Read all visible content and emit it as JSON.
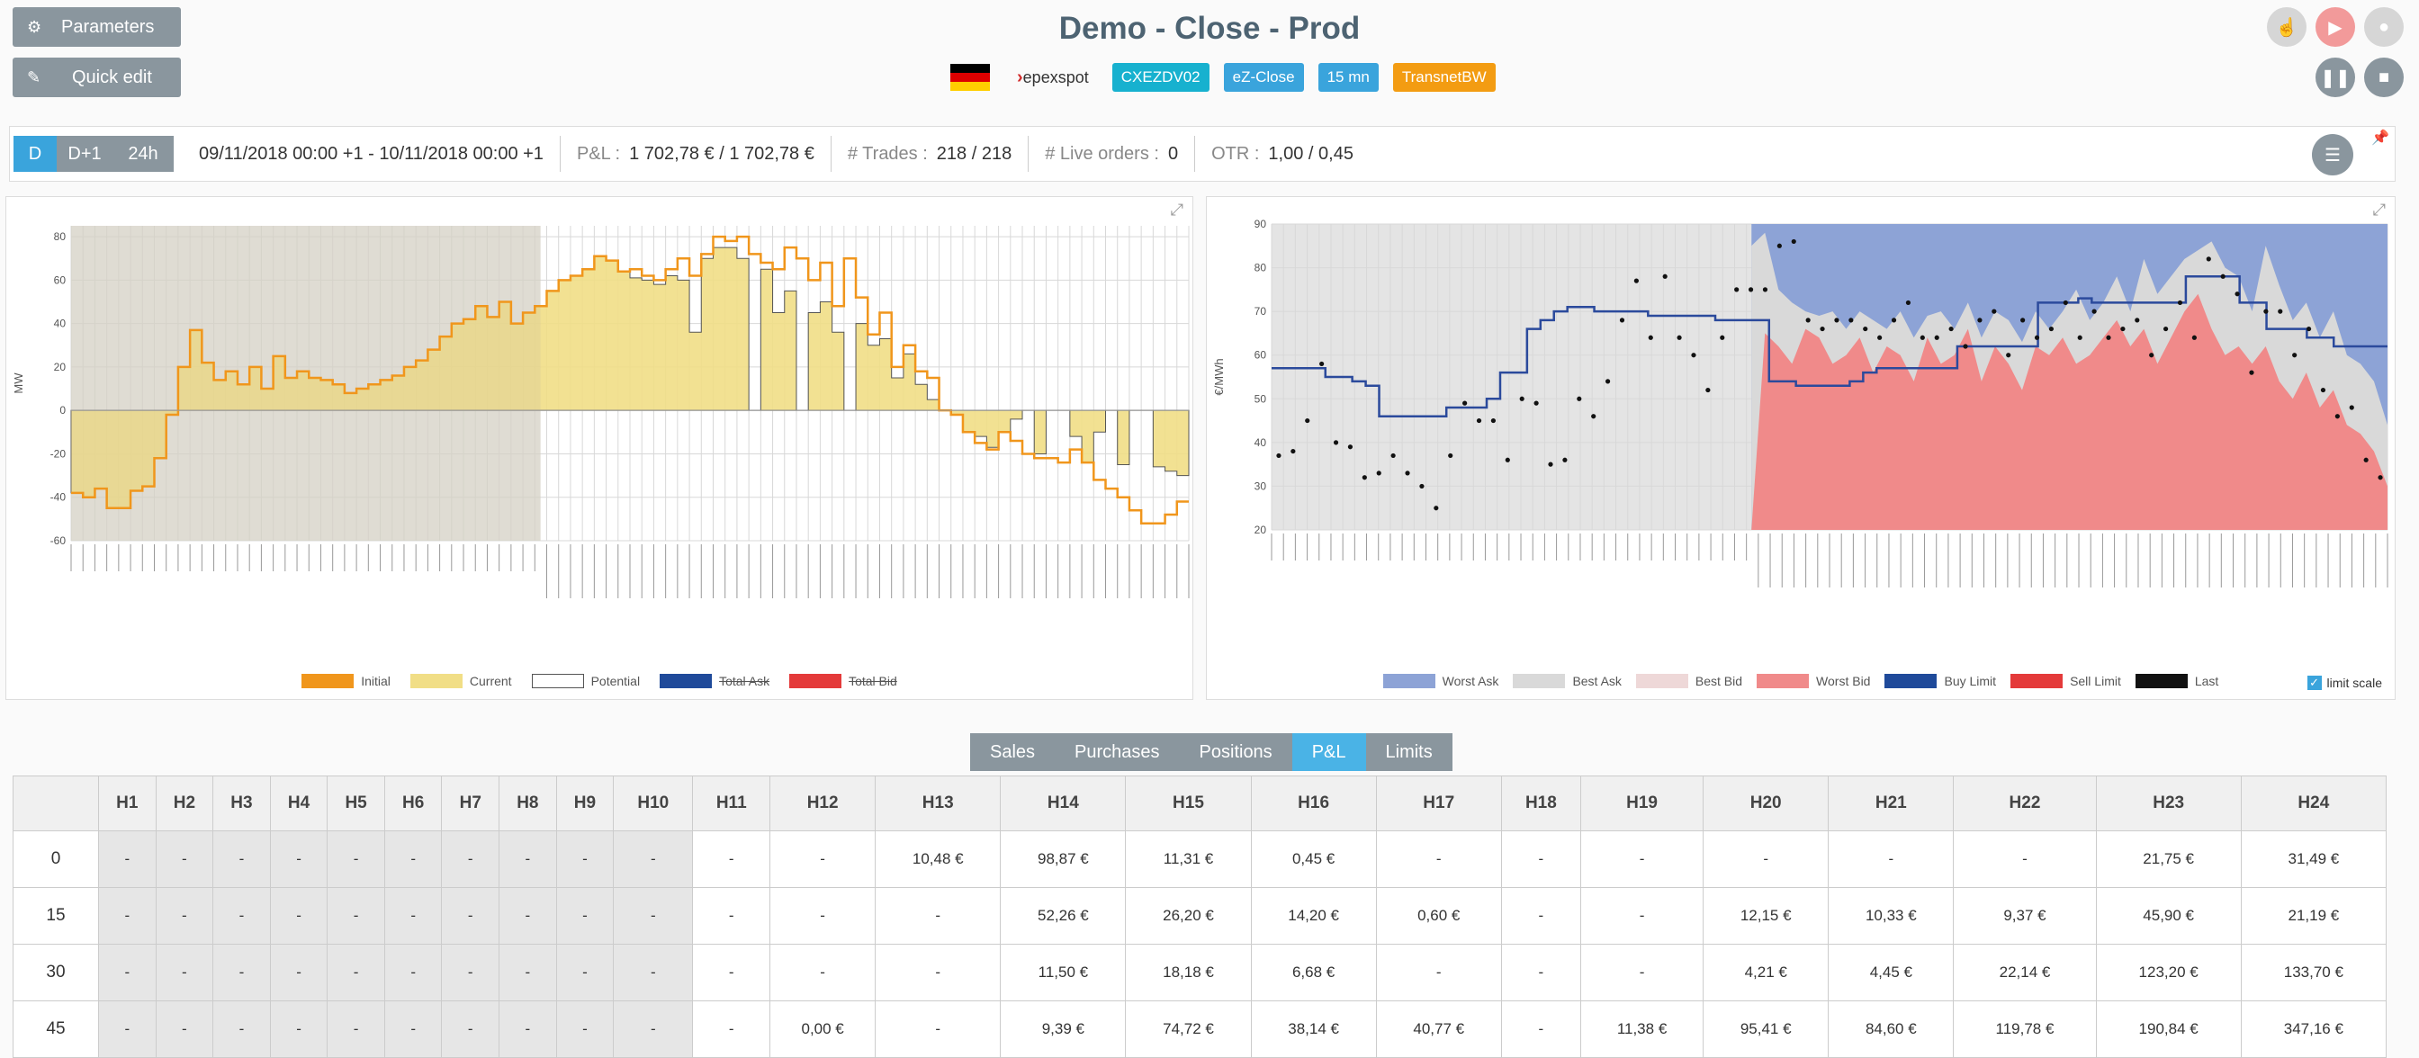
{
  "sidebar": {
    "parameters_label": "Parameters",
    "quick_edit_label": "Quick edit"
  },
  "header": {
    "title": "Demo - Close - Prod",
    "brand": "epexspot",
    "tags": [
      {
        "label": "CXEZDV02",
        "color": "#17b1cf"
      },
      {
        "label": "eZ-Close",
        "color": "#3aa4dc"
      },
      {
        "label": "15 mn",
        "color": "#3aa4dc"
      },
      {
        "label": "TransnetBW",
        "color": "#f39c12"
      }
    ]
  },
  "toolbar": {
    "day_tabs": [
      "D",
      "D+1",
      "24h"
    ],
    "active_day": "D",
    "period": "09/11/2018 00:00 +1 - 10/11/2018 00:00 +1",
    "pnl_label": "P&L :",
    "pnl_value": "1 702,78 € / 1 702,78 €",
    "trades_label": "# Trades :",
    "trades_value": "218 / 218",
    "live_label": "# Live orders :",
    "live_value": "0",
    "otr_label": "OTR :",
    "otr_value": "1,00 / 0,45"
  },
  "left_legend": [
    "Initial",
    "Current",
    "Potential",
    "Total Ask",
    "Total Bid"
  ],
  "right_legend": [
    "Worst Ask",
    "Best Ask",
    "Best Bid",
    "Worst Bid",
    "Buy Limit",
    "Sell Limit",
    "Last"
  ],
  "limit_scale_label": "limit scale",
  "tabs": [
    "Sales",
    "Purchases",
    "Positions",
    "P&L",
    "Limits"
  ],
  "active_tab": "P&L",
  "table": {
    "headers": [
      "H1",
      "H2",
      "H3",
      "H4",
      "H5",
      "H6",
      "H7",
      "H8",
      "H9",
      "H10",
      "H11",
      "H12",
      "H13",
      "H14",
      "H15",
      "H16",
      "H17",
      "H18",
      "H19",
      "H20",
      "H21",
      "H22",
      "H23",
      "H24"
    ],
    "rows": [
      {
        "label": "0",
        "cells": [
          "-",
          "-",
          "-",
          "-",
          "-",
          "-",
          "-",
          "-",
          "-",
          "-",
          "-",
          "-",
          "10,48 €",
          "98,87 €",
          "11,31 €",
          "0,45 €",
          "-",
          "-",
          "-",
          "-",
          "-",
          "-",
          "21,75 €",
          "31,49 €"
        ]
      },
      {
        "label": "15",
        "cells": [
          "-",
          "-",
          "-",
          "-",
          "-",
          "-",
          "-",
          "-",
          "-",
          "-",
          "-",
          "-",
          "-",
          "52,26 €",
          "26,20 €",
          "14,20 €",
          "0,60 €",
          "-",
          "-",
          "12,15 €",
          "10,33 €",
          "9,37 €",
          "45,90 €",
          "21,19 €"
        ]
      },
      {
        "label": "30",
        "cells": [
          "-",
          "-",
          "-",
          "-",
          "-",
          "-",
          "-",
          "-",
          "-",
          "-",
          "-",
          "-",
          "-",
          "11,50 €",
          "18,18 €",
          "6,68 €",
          "-",
          "-",
          "-",
          "4,21 €",
          "4,45 €",
          "22,14 €",
          "123,20 €",
          "133,70 €"
        ]
      },
      {
        "label": "45",
        "cells": [
          "-",
          "-",
          "-",
          "-",
          "-",
          "-",
          "-",
          "-",
          "-",
          "-",
          "-",
          "0,00 €",
          "-",
          "9,39 €",
          "74,72 €",
          "38,14 €",
          "40,77 €",
          "-",
          "11,38 €",
          "95,41 €",
          "84,60 €",
          "119,78 €",
          "190,84 €",
          "347,16 €"
        ]
      }
    ]
  },
  "chart_data": [
    {
      "type": "area",
      "ylabel": "MW",
      "ylim": [
        -60,
        85
      ],
      "yticks": [
        -60,
        -40,
        -20,
        0,
        20,
        40,
        60,
        80
      ],
      "series": [
        {
          "name": "Initial",
          "values": [
            -38,
            -40,
            -36,
            -45,
            -45,
            -37,
            -35,
            -22,
            -2,
            20,
            37,
            22,
            14,
            18,
            12,
            20,
            10,
            25,
            15,
            18,
            15,
            14,
            12,
            8,
            10,
            12,
            14,
            16,
            20,
            23,
            28,
            34,
            40,
            42,
            48,
            43,
            50,
            40,
            45,
            48,
            55,
            60,
            62,
            65,
            71,
            69,
            64,
            65,
            62,
            60,
            65,
            70,
            62,
            72,
            80,
            78,
            80,
            72,
            68,
            65,
            75,
            70,
            60,
            68,
            48,
            70,
            52,
            35,
            45,
            20,
            30,
            18,
            15,
            0,
            -2,
            -10,
            -15,
            -18,
            -10,
            -14,
            -20,
            -22,
            -22,
            -24,
            -18,
            -24,
            -32,
            -36,
            -40,
            -46,
            -52,
            -52,
            -48,
            -42
          ]
        },
        {
          "name": "Current",
          "values": [
            -38,
            -40,
            -36,
            -45,
            -45,
            -37,
            -35,
            -22,
            -2,
            20,
            37,
            22,
            14,
            18,
            12,
            20,
            10,
            25,
            15,
            18,
            15,
            14,
            12,
            8,
            10,
            12,
            14,
            16,
            20,
            23,
            28,
            34,
            40,
            42,
            48,
            43,
            50,
            40,
            45,
            48,
            55,
            60,
            62,
            65,
            71,
            69,
            64,
            61,
            60,
            58,
            62,
            60,
            36,
            70,
            75,
            75,
            70,
            0,
            65,
            45,
            55,
            0,
            45,
            50,
            36,
            0,
            40,
            30,
            33,
            15,
            26,
            12,
            5,
            0,
            -2,
            -10,
            -12,
            -17,
            -10,
            -4,
            0,
            -20,
            0,
            0,
            -12,
            -24,
            -10,
            0,
            -25,
            0,
            0,
            -26,
            -28,
            -30
          ]
        }
      ]
    },
    {
      "type": "area",
      "ylabel": "€/MWh",
      "ylim": [
        20,
        90
      ],
      "yticks": [
        20,
        30,
        40,
        50,
        60,
        70,
        80,
        90
      ],
      "series": [
        {
          "name": "Worst Ask",
          "values": [
            90,
            90,
            90,
            90,
            90,
            90,
            90,
            90,
            90,
            90,
            90,
            90,
            90,
            90,
            90,
            90,
            90,
            90,
            90,
            90,
            90,
            90,
            90,
            90,
            90,
            90,
            90,
            90,
            90,
            90,
            90,
            90,
            90,
            90,
            90,
            90,
            90,
            90,
            90,
            90,
            90,
            90,
            90,
            90,
            90,
            90,
            90,
            90
          ]
        },
        {
          "name": "Best Ask",
          "values": [
            85,
            88,
            75,
            72,
            70,
            69,
            70,
            66,
            70,
            68,
            66,
            70,
            64,
            69,
            70,
            66,
            72,
            64,
            70,
            68,
            63,
            70,
            66,
            70,
            75,
            68,
            72,
            78,
            70,
            82,
            74,
            78,
            82,
            84,
            86,
            80,
            78,
            70,
            85,
            76,
            68,
            72,
            64,
            70,
            60,
            58,
            54,
            44
          ]
        },
        {
          "name": "Worst Bid",
          "values": [
            20,
            65,
            62,
            58,
            66,
            64,
            58,
            60,
            64,
            56,
            62,
            60,
            54,
            64,
            58,
            60,
            66,
            54,
            62,
            58,
            52,
            62,
            60,
            64,
            58,
            60,
            64,
            68,
            62,
            66,
            58,
            64,
            70,
            74,
            66,
            60,
            62,
            58,
            62,
            54,
            50,
            56,
            48,
            52,
            44,
            42,
            38,
            30
          ]
        },
        {
          "name": "Buy Limit",
          "values": [
            57,
            57,
            57,
            57,
            55,
            55,
            54,
            53,
            46,
            46,
            46,
            46,
            46,
            48,
            48,
            48,
            50,
            56,
            56,
            66,
            68,
            70,
            71,
            71,
            70,
            70,
            70,
            70,
            69,
            69,
            69,
            69,
            69,
            68,
            68,
            68,
            68,
            54,
            54,
            53,
            53,
            53,
            53,
            54,
            56,
            57,
            57,
            57,
            57,
            57,
            57,
            62,
            62,
            62,
            62,
            62,
            62,
            72,
            72,
            72,
            73,
            72,
            72,
            72,
            72,
            72,
            72,
            72,
            78,
            78,
            78,
            78,
            72,
            72,
            66,
            66,
            66,
            64,
            64,
            62,
            62,
            62,
            62
          ]
        },
        {
          "name": "Last",
          "values": [
            37,
            38,
            45,
            58,
            40,
            39,
            32,
            33,
            37,
            33,
            30,
            25,
            37,
            49,
            45,
            45,
            36,
            50,
            49,
            35,
            36,
            50,
            46,
            54,
            68,
            77,
            64,
            78,
            64,
            60,
            52,
            64,
            75,
            75,
            75,
            85,
            86,
            68,
            66,
            68,
            68,
            66,
            64,
            68,
            72,
            64,
            64,
            66,
            62,
            68,
            70,
            60,
            68,
            64,
            66,
            72,
            64,
            70,
            64,
            66,
            68,
            60,
            66,
            72,
            64,
            82,
            78,
            74,
            56,
            70,
            70,
            60,
            66,
            52,
            46,
            48,
            36,
            32
          ]
        }
      ]
    }
  ]
}
